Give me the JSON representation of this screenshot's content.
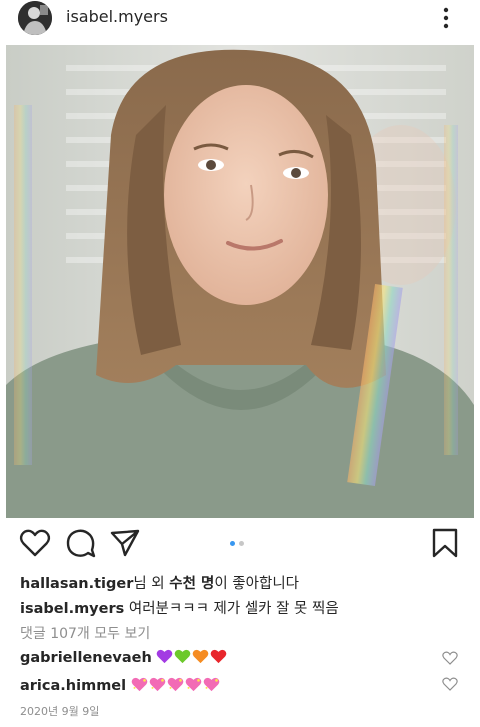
{
  "header": {
    "username": "isabel.myers",
    "avatar_icon": "profile-avatar",
    "more_icon": "more-vertical-icon"
  },
  "post": {
    "image_alt": "selfie photo",
    "carousel": {
      "current": 1,
      "total": 2
    }
  },
  "actions": {
    "like_icon": "heart-outline-icon",
    "comment_icon": "comment-bubble-icon",
    "share_icon": "paper-plane-icon",
    "save_icon": "bookmark-icon"
  },
  "likes": {
    "user": "hallasan.tiger",
    "text_1": "님 외 ",
    "count_text": "수천 명",
    "text_2": "이 좋아합니다"
  },
  "caption": {
    "user": "isabel.myers",
    "text": "여러분ㅋㅋㅋ 제가 셀카 잘 못 찍음"
  },
  "view_comments": "댓글 107개 모두 보기",
  "comments": [
    {
      "user": "gabriellenevaeh",
      "emojis": [
        "purple-heart",
        "green-heart",
        "orange-heart",
        "red-heart"
      ]
    },
    {
      "user": "arica.himmel",
      "emojis": [
        "sparkling-heart",
        "sparkling-heart",
        "sparkling-heart",
        "sparkling-heart",
        "sparkling-heart"
      ]
    }
  ],
  "date": "2020년 9월 9일",
  "colors": {
    "accent_blue": "#3897f0",
    "text": "#262626",
    "muted": "#8e8e8e"
  }
}
